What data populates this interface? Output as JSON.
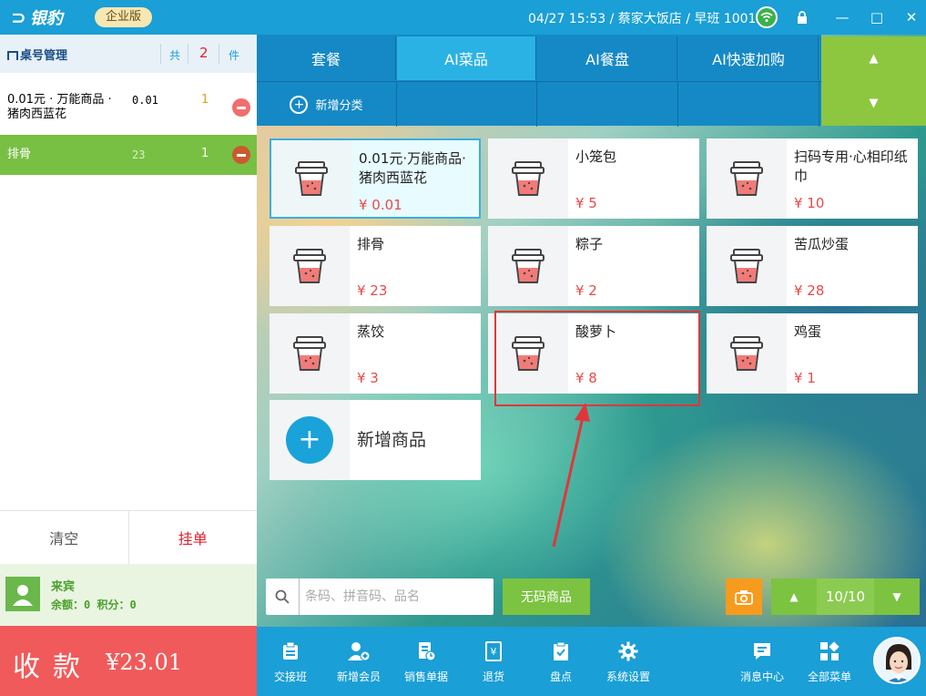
{
  "titlebar": {
    "app_name": "银豹",
    "edition": "企业版",
    "status": "04/27 15:53 / 蔡家大饭店 / 早班 1001",
    "minimize": "—",
    "maximize": "□",
    "close": "✕"
  },
  "order": {
    "header_title": "桌号管理",
    "total_label": "共",
    "total_count": "2",
    "unit_label": "件",
    "items": [
      {
        "name": "0.01元 · 万能商品 · 猪肉西蓝花",
        "price": "0.01",
        "qty": "1"
      },
      {
        "name": "排骨",
        "price": "23",
        "qty": "1"
      }
    ]
  },
  "left_actions": {
    "clear": "清空",
    "hold": "挂单"
  },
  "member": {
    "name": "来宾",
    "info": "余额：0 积分：0"
  },
  "pay": {
    "label": "收款",
    "amount": "¥23.01"
  },
  "tabs": [
    {
      "label": "套餐"
    },
    {
      "label": "AI菜品"
    },
    {
      "label": "AI餐盘"
    },
    {
      "label": "AI快速加购"
    }
  ],
  "add_category": "新增分类",
  "nav": {
    "up": "▲",
    "down": "▼"
  },
  "products": [
    {
      "name": "0.01元·万能商品·猪肉西蓝花",
      "price": "¥ 0.01"
    },
    {
      "name": "小笼包",
      "price": "¥ 5"
    },
    {
      "name": "扫码专用·心相印纸巾",
      "price": "¥ 10"
    },
    {
      "name": "排骨",
      "price": "¥ 23"
    },
    {
      "name": "粽子",
      "price": "¥ 2"
    },
    {
      "name": "苦瓜炒蛋",
      "price": "¥ 28"
    },
    {
      "name": "蒸饺",
      "price": "¥ 3"
    },
    {
      "name": "酸萝卜",
      "price": "¥ 8"
    },
    {
      "name": "鸡蛋",
      "price": "¥ 1"
    }
  ],
  "add_product": "新增商品",
  "search": {
    "placeholder": "条码、拼音码、品名"
  },
  "nocode_button": "无码商品",
  "pagination": {
    "current": "10/10",
    "up": "▲",
    "down": "▼"
  },
  "toolbar": [
    {
      "label": "交接班",
      "icon": "handover-icon"
    },
    {
      "label": "新增会员",
      "icon": "add-member-icon"
    },
    {
      "label": "销售单据",
      "icon": "sales-doc-icon"
    },
    {
      "label": "退货",
      "icon": "return-icon"
    },
    {
      "label": "盘点",
      "icon": "inventory-icon"
    },
    {
      "label": "系统设置",
      "icon": "gear-icon"
    },
    {
      "label": "消息中心",
      "icon": "message-icon"
    },
    {
      "label": "全部菜单",
      "icon": "all-menu-icon"
    }
  ],
  "colors": {
    "primary": "#1a9fd6",
    "green": "#7cc342",
    "pay_red": "#f15a5a",
    "price_red": "#e84a4a",
    "highlight": "#e0363b"
  }
}
